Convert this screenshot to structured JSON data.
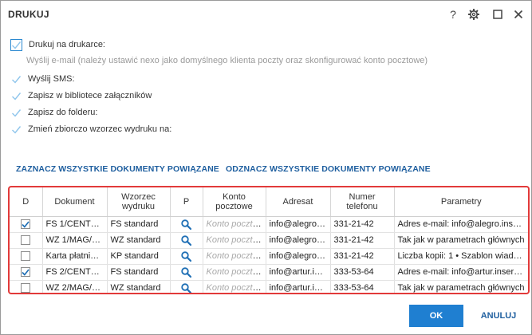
{
  "dialog": {
    "title": "DRUKUJ",
    "icons": [
      "help-icon",
      "gear-icon",
      "maximize-icon",
      "close-icon"
    ],
    "help_glyph": "?"
  },
  "options": {
    "print_label": "Drukuj na drukarce:",
    "email_label": "Wyślij e-mail (należy ustawić nexo jako domyślnego klienta poczty oraz skonfigurować konto pocztowe)",
    "sms_label": "Wyślij SMS:",
    "library_label": "Zapisz w bibliotece załączników",
    "folder_label": "Zapisz do folderu:",
    "template_label": "Zmień zbiorczo wzorzec wydruku na:"
  },
  "links": {
    "select_all": "ZAZNACZ WSZYSTKIE DOKUMENTY POWIĄZANE",
    "deselect_all": "ODZNACZ WSZYSTKIE DOKUMENTY POWIĄZANE"
  },
  "table": {
    "headers": {
      "d": "D",
      "dokument": "Dokument",
      "wzorzec": "Wzorzec wydruku",
      "p": "P",
      "konto": "Konto pocztowe",
      "adresat": "Adresat",
      "numer": "Numer telefonu",
      "parametry": "Parametry"
    },
    "rows": [
      {
        "checked": true,
        "dokument": "FS 1/CENTRA...",
        "wzorzec": "FS standard",
        "konto": "Konto pocztowe",
        "adresat": "info@alegro.i...",
        "numer": "331-21-42",
        "parametry": "Adres e-mail: info@alegro.insert.c..."
      },
      {
        "checked": false,
        "dokument": "WZ 1/MAG/2...",
        "wzorzec": "WZ standard",
        "konto": "Konto pocztowe",
        "adresat": "info@alegro.i...",
        "numer": "331-21-42",
        "parametry": "Tak jak w parametrach głównych"
      },
      {
        "checked": false,
        "dokument": "Karta płatnicza",
        "wzorzec": "KP standard",
        "konto": "Konto pocztowe",
        "adresat": "info@alegro.i...",
        "numer": "331-21-42",
        "parametry": "Liczba kopii: 1 • Szablon wiado..."
      },
      {
        "checked": true,
        "dokument": "FS 2/CENTRA...",
        "wzorzec": "FS standard",
        "konto": "Konto pocztowe",
        "adresat": "info@artur.ins...",
        "numer": "333-53-64",
        "parametry": "Adres e-mail: info@artur.insert.c..."
      },
      {
        "checked": false,
        "dokument": "WZ 2/MAG/2...",
        "wzorzec": "WZ standard",
        "konto": "Konto pocztowe",
        "adresat": "info@artur.ins...",
        "numer": "333-53-64",
        "parametry": "Tak jak w parametrach głównych"
      }
    ]
  },
  "buttons": {
    "ok": "OK",
    "cancel": "ANULUJ"
  },
  "colors": {
    "accent": "#1f7fd1",
    "link": "#1f5f9f",
    "highlight_border": "#e23a3a",
    "check": "#8ec5ec"
  }
}
